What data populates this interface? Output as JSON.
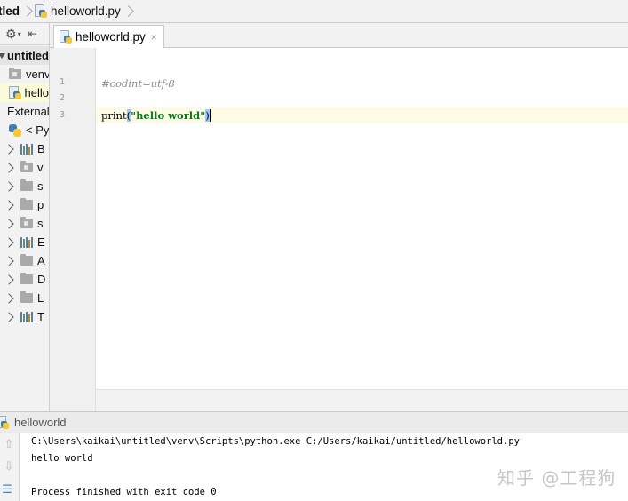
{
  "breadcrumb": [
    {
      "label": "tled"
    },
    {
      "label": "helloworld.py"
    }
  ],
  "project_tree": {
    "toolbar_icons": [
      "gear-icon",
      "collapse-icon"
    ],
    "items": [
      {
        "label": "untitled",
        "kind": "root"
      },
      {
        "label": "venv",
        "kind": "folder"
      },
      {
        "label": "hello",
        "kind": "pyfile",
        "selected": true
      },
      {
        "label": "External",
        "kind": "external"
      },
      {
        "label": "< Py",
        "kind": "python"
      },
      {
        "label": "B",
        "kind": "lib"
      },
      {
        "label": "v",
        "kind": "folder-dot"
      },
      {
        "label": "s",
        "kind": "folder"
      },
      {
        "label": "p",
        "kind": "folder"
      },
      {
        "label": "s",
        "kind": "folder-dot"
      },
      {
        "label": "E",
        "kind": "lib"
      },
      {
        "label": "A",
        "kind": "folder"
      },
      {
        "label": "D",
        "kind": "folder"
      },
      {
        "label": "L",
        "kind": "folder"
      },
      {
        "label": "T",
        "kind": "lib"
      }
    ]
  },
  "editor": {
    "tab_label": "helloworld.py",
    "tab_close": "×",
    "line_numbers": [
      "1",
      "2",
      "3"
    ],
    "lines": {
      "l1": "#codint=utf-8",
      "l3_func": "print",
      "l3_open": "(",
      "l3_str": "\"hello world\"",
      "l3_close": ")"
    }
  },
  "run_panel": {
    "tab_label": "helloworld",
    "console": [
      "C:\\Users\\kaikai\\untitled\\venv\\Scripts\\python.exe C:/Users/kaikai/untitled/helloworld.py",
      "hello world",
      "",
      "Process finished with exit code 0"
    ]
  },
  "watermark": "知乎 @工程狗",
  "colors": {
    "string": "#067d17",
    "comment": "#8c8c8c",
    "current_line": "#fdfbe8",
    "selected_row": "#fbfbd8",
    "brace_match": "#99ccff"
  }
}
